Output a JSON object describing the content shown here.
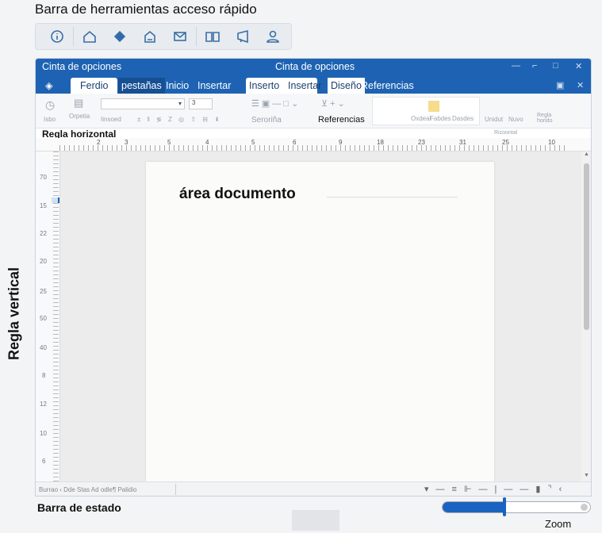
{
  "annotations": {
    "qat": "Barra de herramientas acceso rápido",
    "vertical_ruler": "Regla vertical",
    "horizontal_ruler": "Regla horizontal",
    "status_bar": "Barra de estado",
    "zoom": "Zoom"
  },
  "qat": {
    "icons": [
      "info-icon",
      "home-icon",
      "brush-icon",
      "inbox-icon",
      "mail-icon",
      "book-icon",
      "megaphone-icon",
      "user-icon"
    ]
  },
  "window": {
    "title_left": "Cinta de opciones",
    "title_center": "Cinta de opciones",
    "tabs": [
      "Ferdio",
      "pestañas",
      "Inicio",
      "Insertar",
      "Inserto",
      "Insertar",
      "Diseño",
      "Referencias"
    ]
  },
  "ribbon": {
    "labels": [
      "Isbo",
      "Orpetia",
      "Iinsoed",
      "Seroriña",
      "Referencias",
      "Oxdeal",
      "Fabdes",
      "Dasdes",
      "Unidut",
      "Nuvo",
      "Regla horido",
      "Rizoontal"
    ],
    "font_value": "3"
  },
  "hruler": {
    "ticks": [
      "2",
      "3",
      "5",
      "4",
      "5",
      "6",
      "9",
      "18",
      "23",
      "31",
      "25",
      "10"
    ]
  },
  "vruler": {
    "ticks": [
      "70",
      "15",
      "22",
      "20",
      "25",
      "50",
      "40",
      "8",
      "12",
      "10",
      "6"
    ]
  },
  "document": {
    "title": "área documento"
  },
  "status": {
    "text": "Burrao  ‹  Dde Stas  Ad odle¶ Palidio"
  },
  "zoom": {
    "level": 0.42
  },
  "colors": {
    "accent": "#1e63b3"
  }
}
